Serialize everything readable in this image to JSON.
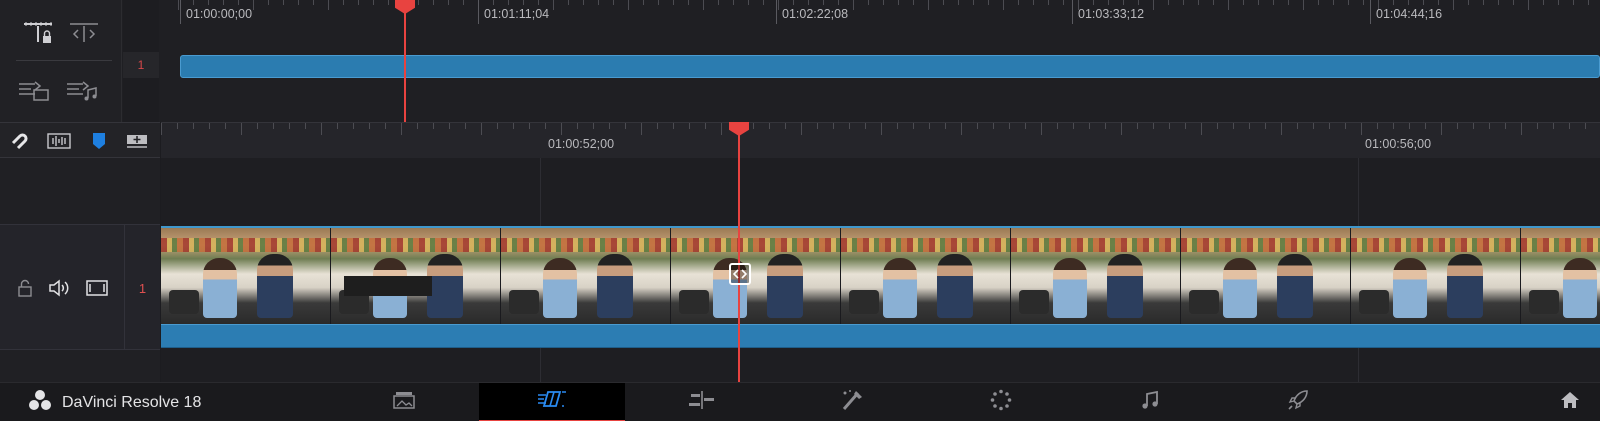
{
  "app": {
    "name": "DaVinci Resolve 18"
  },
  "upper_timeline": {
    "timecodes": [
      "01:00:00;00",
      "01:01:11;04",
      "01:02:22;08",
      "01:03:33;12",
      "01:04:44;16"
    ],
    "track_number": "1",
    "tools": [
      "timeline-lock-icon",
      "timeline-range-icon",
      "insert-video-icon",
      "insert-audio-icon"
    ]
  },
  "lower_timeline": {
    "timecodes": [
      "01:00:52;00",
      "01:00:56;00"
    ],
    "tools": [
      "snap-magnet-icon",
      "audio-waveform-icon",
      "marker-icon",
      "add-track-icon"
    ],
    "track_number": "1",
    "track_controls": [
      "lock-icon",
      "speaker-icon",
      "clip-view-icon"
    ],
    "thumbnail_count": 9
  },
  "bottom_bar": {
    "pages": [
      {
        "name": "media",
        "icon": "media-page-icon"
      },
      {
        "name": "cut",
        "icon": "cut-page-icon",
        "active": true
      },
      {
        "name": "edit",
        "icon": "edit-page-icon"
      },
      {
        "name": "fusion",
        "icon": "fusion-page-icon"
      },
      {
        "name": "color",
        "icon": "color-page-icon"
      },
      {
        "name": "fairlight",
        "icon": "fairlight-page-icon"
      },
      {
        "name": "deliver",
        "icon": "deliver-page-icon"
      }
    ],
    "home_icon": "home-icon"
  },
  "colors": {
    "playhead": "#e84340",
    "clip_blue": "#2b7cb0",
    "track_number_red": "#e05050",
    "active_page_underline": "#e84340"
  }
}
